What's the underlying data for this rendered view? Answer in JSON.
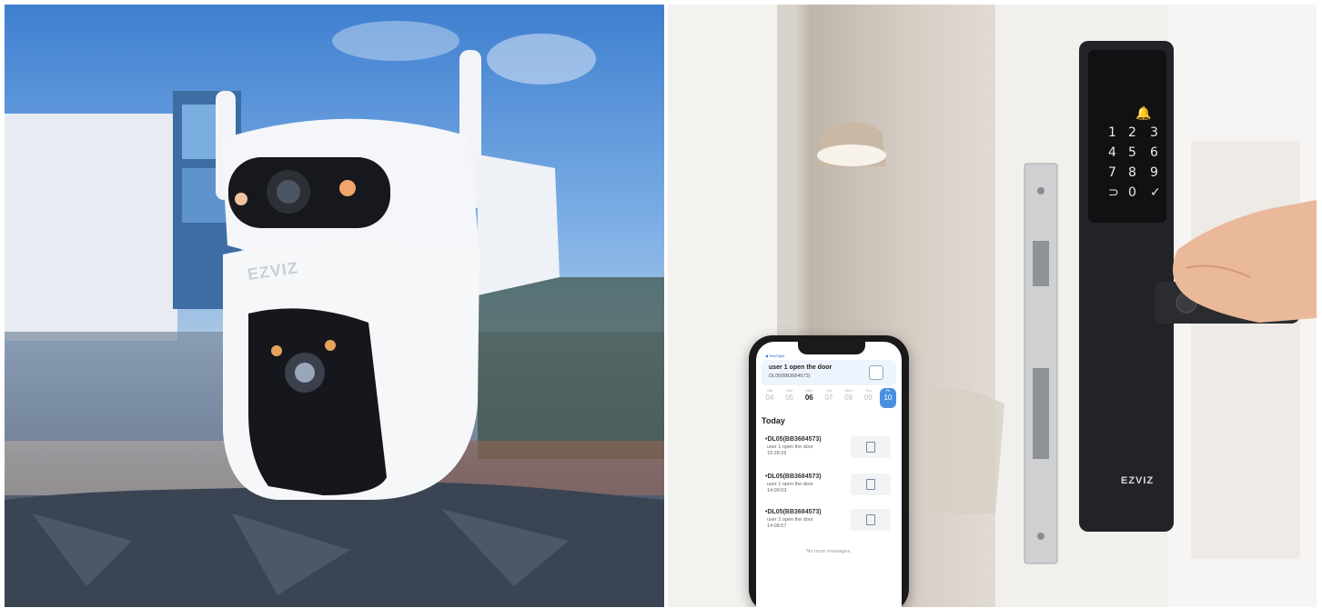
{
  "camera": {
    "brand": "EZVIZ"
  },
  "lock": {
    "brand": "EZVIZ",
    "keypad": [
      [
        "1",
        "2",
        "3"
      ],
      [
        "4",
        "5",
        "6"
      ],
      [
        "7",
        "8",
        "9"
      ],
      [
        "⊃",
        "0",
        "✓"
      ]
    ],
    "bell_icon": "bell-icon"
  },
  "phone": {
    "status": "◀ TestFlight",
    "notification": {
      "title": "user 1 open the door",
      "subtitle": "DL05(BB3684573)"
    },
    "days": [
      {
        "name": "Sat",
        "num": "04"
      },
      {
        "name": "Sun",
        "num": "05"
      },
      {
        "name": "Mon",
        "num": "06"
      },
      {
        "name": "Tue",
        "num": "07"
      },
      {
        "name": "Wed",
        "num": "08"
      },
      {
        "name": "Thu",
        "num": "09"
      },
      {
        "name": "Fri",
        "num": "10"
      }
    ],
    "today_label": "Today",
    "messages": [
      {
        "title": "•DL05(BB3684573)",
        "text": "user 1 open the door",
        "time": "15:28:26"
      },
      {
        "title": "•DL05(BB3684573)",
        "text": "user 1 open the door",
        "time": "14:09:03"
      },
      {
        "title": "•DL05(BB3684573)",
        "text": "user 2 open the door",
        "time": "14:08:57"
      }
    ],
    "footer": "No more messages."
  }
}
